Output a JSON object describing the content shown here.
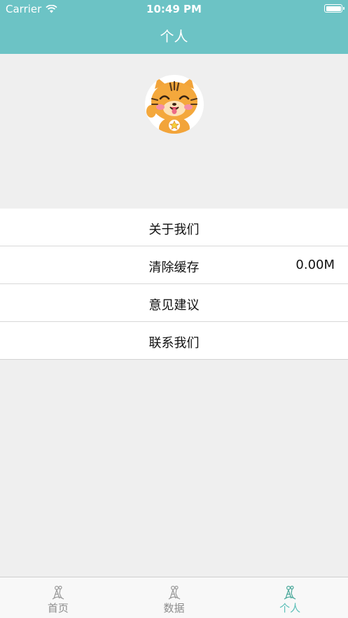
{
  "status_bar": {
    "carrier": "Carrier",
    "time": "10:49 PM"
  },
  "nav": {
    "title": "个人"
  },
  "colors": {
    "accent": "#6cc3c5",
    "active_tab": "#5bbfb8",
    "inactive_tab": "#8c8c8c",
    "background": "#efefef"
  },
  "profile": {
    "avatar_icon": "tiger-cartoon-icon"
  },
  "menu": {
    "items": [
      {
        "label": "关于我们",
        "value": ""
      },
      {
        "label": "清除缓存",
        "value": "0.00M"
      },
      {
        "label": "意见建议",
        "value": ""
      },
      {
        "label": "联系我们",
        "value": ""
      }
    ]
  },
  "tabbar": {
    "tabs": [
      {
        "label": "首页",
        "icon": "home-figure-icon",
        "active": false
      },
      {
        "label": "数据",
        "icon": "data-figure-icon",
        "active": false
      },
      {
        "label": "个人",
        "icon": "person-figure-icon",
        "active": true
      }
    ]
  }
}
